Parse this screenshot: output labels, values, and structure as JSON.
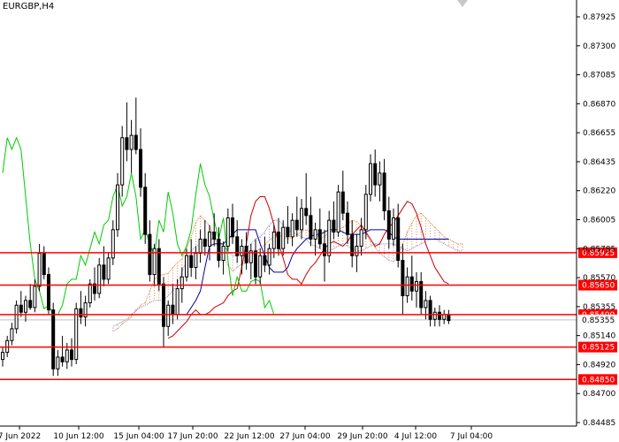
{
  "window": {
    "title": "EURGBP,H4"
  },
  "colors": {
    "background": "#ffffff",
    "candles": "#000000",
    "level_line": "#ff0000",
    "level_label_bg": "#ff0000",
    "chikou": "#00cc00",
    "tenkan": "#cc0000",
    "kijun": "#0000aa",
    "kumo_up": "#e08040",
    "kumo_down": "#9080c0",
    "bid_line": "#c0c0c0"
  },
  "price_axis": {
    "min": 0.84485,
    "max": 0.87925,
    "ticks": [
      "0.87925",
      "0.87300",
      "0.87085",
      "0.86870",
      "0.86655",
      "0.86435",
      "0.86220",
      "0.86005",
      "0.85785",
      "0.85570",
      "0.85355",
      "0.85140",
      "0.84920",
      "0.84700",
      "0.84485"
    ]
  },
  "time_axis": {
    "labels": [
      "7 Jun 2022",
      "10 Jun 12:00",
      "15 Jun 04:00",
      "17 Jun 20:00",
      "22 Jun 12:00",
      "27 Jun 04:00",
      "29 Jun 20:00",
      "4 Jul 12:00",
      "7 Jul 04:00"
    ]
  },
  "levels": [
    {
      "price": 0.85925,
      "label": "0.85925"
    },
    {
      "price": 0.8565,
      "label": "0.85650"
    },
    {
      "price": 0.854,
      "label": "0.85400"
    },
    {
      "price": 0.85125,
      "label": "0.85125"
    },
    {
      "price": 0.8485,
      "label": "0.84850"
    }
  ],
  "bid": {
    "price": 0.85355,
    "label": "0.85355"
  },
  "candles": [
    [
      0.8502,
      0.8512,
      0.8496,
      0.8508
    ],
    [
      0.8508,
      0.8522,
      0.8504,
      0.8518
    ],
    [
      0.8518,
      0.8533,
      0.8514,
      0.8528
    ],
    [
      0.8528,
      0.8552,
      0.8524,
      0.8548
    ],
    [
      0.8548,
      0.856,
      0.8538,
      0.8542
    ],
    [
      0.8542,
      0.8556,
      0.8534,
      0.8552
    ],
    [
      0.8552,
      0.8566,
      0.8544,
      0.8546
    ],
    [
      0.8546,
      0.857,
      0.8542,
      0.8564
    ],
    [
      0.8564,
      0.86,
      0.856,
      0.8592
    ],
    [
      0.8592,
      0.8598,
      0.857,
      0.8574
    ],
    [
      0.8574,
      0.858,
      0.854,
      0.8544
    ],
    [
      0.8544,
      0.855,
      0.8488,
      0.8494
    ],
    [
      0.8494,
      0.851,
      0.8488,
      0.8504
    ],
    [
      0.8504,
      0.8522,
      0.8496,
      0.85
    ],
    [
      0.85,
      0.8516,
      0.8494,
      0.851
    ],
    [
      0.851,
      0.852,
      0.8496,
      0.8502
    ],
    [
      0.8502,
      0.855,
      0.8498,
      0.8545
    ],
    [
      0.8545,
      0.856,
      0.8532,
      0.8538
    ],
    [
      0.8538,
      0.8556,
      0.853,
      0.855
    ],
    [
      0.855,
      0.857,
      0.8546,
      0.8566
    ],
    [
      0.8566,
      0.858,
      0.8552,
      0.8558
    ],
    [
      0.8558,
      0.8588,
      0.8554,
      0.8582
    ],
    [
      0.8582,
      0.8598,
      0.8564,
      0.857
    ],
    [
      0.857,
      0.8592,
      0.8566,
      0.8588
    ],
    [
      0.8588,
      0.862,
      0.8582,
      0.8612
    ],
    [
      0.8612,
      0.866,
      0.8606,
      0.865
    ],
    [
      0.865,
      0.87,
      0.864,
      0.869
    ],
    [
      0.869,
      0.872,
      0.867,
      0.868
    ],
    [
      0.868,
      0.8705,
      0.866,
      0.8692
    ],
    [
      0.8692,
      0.8724,
      0.8676,
      0.868
    ],
    [
      0.868,
      0.8698,
      0.864,
      0.8648
    ],
    [
      0.8648,
      0.866,
      0.86,
      0.8608
    ],
    [
      0.8608,
      0.862,
      0.8568,
      0.8574
    ],
    [
      0.8574,
      0.86,
      0.8564,
      0.8596
    ],
    [
      0.8596,
      0.8604,
      0.856,
      0.8566
    ],
    [
      0.8566,
      0.8572,
      0.8512,
      0.853
    ],
    [
      0.853,
      0.8552,
      0.8522,
      0.8548
    ],
    [
      0.8548,
      0.8566,
      0.8532,
      0.854
    ],
    [
      0.854,
      0.857,
      0.8536,
      0.8562
    ],
    [
      0.8562,
      0.858,
      0.855,
      0.8572
    ],
    [
      0.8572,
      0.8596,
      0.8568,
      0.859
    ],
    [
      0.859,
      0.8604,
      0.8572,
      0.858
    ],
    [
      0.858,
      0.8598,
      0.857,
      0.8592
    ],
    [
      0.8592,
      0.8612,
      0.8584,
      0.8604
    ],
    [
      0.8604,
      0.862,
      0.859,
      0.8598
    ],
    [
      0.8598,
      0.8616,
      0.8586,
      0.861
    ],
    [
      0.861,
      0.8626,
      0.8598,
      0.8604
    ],
    [
      0.8604,
      0.8614,
      0.858,
      0.8586
    ],
    [
      0.8586,
      0.8602,
      0.8574,
      0.8598
    ],
    [
      0.8598,
      0.863,
      0.8594,
      0.8622
    ],
    [
      0.8622,
      0.8634,
      0.86,
      0.8606
    ],
    [
      0.8606,
      0.862,
      0.8584,
      0.859
    ],
    [
      0.859,
      0.8604,
      0.8574,
      0.8598
    ],
    [
      0.8598,
      0.861,
      0.8578,
      0.8584
    ],
    [
      0.8584,
      0.86,
      0.857,
      0.8594
    ],
    [
      0.8594,
      0.8604,
      0.8566,
      0.8572
    ],
    [
      0.8572,
      0.8596,
      0.8566,
      0.859
    ],
    [
      0.859,
      0.8606,
      0.8576,
      0.8582
    ],
    [
      0.8582,
      0.86,
      0.8574,
      0.8596
    ],
    [
      0.8596,
      0.8616,
      0.8588,
      0.861
    ],
    [
      0.861,
      0.8622,
      0.859,
      0.8596
    ],
    [
      0.8596,
      0.862,
      0.859,
      0.8614
    ],
    [
      0.8614,
      0.8632,
      0.86,
      0.8606
    ],
    [
      0.8606,
      0.8626,
      0.8598,
      0.862
    ],
    [
      0.862,
      0.864,
      0.8606,
      0.8612
    ],
    [
      0.8612,
      0.8638,
      0.8604,
      0.863
    ],
    [
      0.863,
      0.866,
      0.8616,
      0.8624
    ],
    [
      0.8624,
      0.864,
      0.8598,
      0.8604
    ],
    [
      0.8604,
      0.8618,
      0.859,
      0.8612
    ],
    [
      0.8612,
      0.863,
      0.8596,
      0.86
    ],
    [
      0.86,
      0.8612,
      0.8568,
      0.859
    ],
    [
      0.859,
      0.8628,
      0.8584,
      0.862
    ],
    [
      0.862,
      0.8636,
      0.8604,
      0.861
    ],
    [
      0.861,
      0.865,
      0.8606,
      0.8644
    ],
    [
      0.8644,
      0.8662,
      0.862,
      0.8626
    ],
    [
      0.8626,
      0.8636,
      0.86,
      0.8608
    ],
    [
      0.8608,
      0.862,
      0.858,
      0.859
    ],
    [
      0.859,
      0.8608,
      0.8576,
      0.8598
    ],
    [
      0.8598,
      0.8622,
      0.859,
      0.8612
    ],
    [
      0.8612,
      0.865,
      0.8604,
      0.8642
    ],
    [
      0.8642,
      0.8676,
      0.8636,
      0.8668
    ],
    [
      0.8668,
      0.868,
      0.864,
      0.865
    ],
    [
      0.865,
      0.867,
      0.8636,
      0.866
    ],
    [
      0.866,
      0.8672,
      0.862,
      0.8628
    ],
    [
      0.8628,
      0.864,
      0.8596,
      0.8604
    ],
    [
      0.8604,
      0.863,
      0.8598,
      0.8622
    ],
    [
      0.8622,
      0.8634,
      0.858,
      0.8586
    ],
    [
      0.8586,
      0.86,
      0.854,
      0.8556
    ],
    [
      0.8556,
      0.858,
      0.855,
      0.8572
    ],
    [
      0.8572,
      0.859,
      0.8552,
      0.856
    ],
    [
      0.856,
      0.8576,
      0.8546,
      0.8568
    ],
    [
      0.8568,
      0.8576,
      0.854,
      0.8546
    ],
    [
      0.8546,
      0.856,
      0.8536,
      0.8552
    ],
    [
      0.8552,
      0.8556,
      0.853,
      0.8536
    ],
    [
      0.8536,
      0.8546,
      0.853,
      0.8542
    ],
    [
      0.8542,
      0.8548,
      0.853,
      0.8536
    ],
    [
      0.8536,
      0.8544,
      0.8532,
      0.854
    ],
    [
      0.854,
      0.8544,
      0.8532,
      0.8535
    ]
  ],
  "indicators": {
    "tenkan": [
      0.852,
      0.8522,
      0.8526,
      0.853,
      0.8534,
      0.854,
      0.8544,
      0.854,
      0.854,
      0.8542,
      0.8546,
      0.8548,
      0.855,
      0.8556,
      0.856,
      0.8562,
      0.858,
      0.86,
      0.8624,
      0.8636,
      0.864,
      0.864,
      0.863,
      0.8616,
      0.86,
      0.8588,
      0.8574,
      0.857,
      0.857,
      0.8566,
      0.8574,
      0.858,
      0.8584,
      0.859,
      0.8596,
      0.86,
      0.8602,
      0.86,
      0.8598,
      0.8602,
      0.8608,
      0.8612,
      0.8616,
      0.861,
      0.8604,
      0.8598,
      0.86,
      0.8608,
      0.8614,
      0.8618,
      0.8624,
      0.863,
      0.8636,
      0.8634,
      0.8626,
      0.8614,
      0.86,
      0.859,
      0.858,
      0.8574,
      0.8568,
      0.8566
    ],
    "kijun": [
      0.854,
      0.854,
      0.854,
      0.854,
      0.854,
      0.8546,
      0.8552,
      0.856,
      0.858,
      0.8598,
      0.86,
      0.86,
      0.86,
      0.8604,
      0.8608,
      0.8612,
      0.8612,
      0.8612,
      0.8612,
      0.8612,
      0.86,
      0.859,
      0.858,
      0.8576,
      0.8576,
      0.8576,
      0.858,
      0.859,
      0.8596,
      0.86,
      0.8604,
      0.8606,
      0.8608,
      0.8608,
      0.861,
      0.8612,
      0.8612,
      0.8612,
      0.861,
      0.8608,
      0.8608,
      0.8608,
      0.8608,
      0.861,
      0.8612,
      0.8612,
      0.8612,
      0.8612,
      0.861,
      0.8606,
      0.8604,
      0.8604,
      0.8604,
      0.8604,
      0.8604,
      0.8604,
      0.8604,
      0.8604,
      0.8604,
      0.8604,
      0.8604,
      0.8604
    ],
    "chikou": [
      0.866,
      0.869,
      0.868,
      0.869,
      0.868,
      0.864,
      0.86,
      0.857,
      0.856,
      0.8545,
      0.8548,
      0.854,
      0.854,
      0.8548,
      0.8566,
      0.857,
      0.857,
      0.859,
      0.8582,
      0.8596,
      0.861,
      0.86,
      0.8616,
      0.862,
      0.864,
      0.865,
      0.8632,
      0.864,
      0.866,
      0.864,
      0.8604,
      0.8612,
      0.86,
      0.859,
      0.862,
      0.861,
      0.8644,
      0.8626,
      0.86,
      0.859,
      0.8598,
      0.8612,
      0.8642,
      0.8668,
      0.865,
      0.864,
      0.862,
      0.8604,
      0.8622,
      0.8586,
      0.8556,
      0.8572,
      0.856,
      0.856,
      0.8568,
      0.857,
      0.8568,
      0.8546,
      0.8552,
      0.854,
      0.854,
      0.854
    ],
    "senkou_a": [
      0.8526,
      0.8528,
      0.8532,
      0.8535,
      0.8538,
      0.8543,
      0.8548,
      0.855,
      0.856,
      0.857,
      0.8573,
      0.8574,
      0.8575,
      0.858,
      0.8584,
      0.8587,
      0.8596,
      0.8606,
      0.8618,
      0.8624,
      0.862,
      0.8615,
      0.8605,
      0.8596,
      0.8588,
      0.8582,
      0.8577,
      0.858,
      0.8583,
      0.8583,
      0.8589,
      0.8593,
      0.8596,
      0.8599,
      0.8603,
      0.8606,
      0.8607,
      0.8606,
      0.8604,
      0.8605,
      0.8608,
      0.861,
      0.8612,
      0.861,
      0.8608,
      0.8605,
      0.8606,
      0.861,
      0.8612,
      0.8612,
      0.8614,
      0.8617,
      0.862,
      0.8619,
      0.8615,
      0.8609,
      0.8602,
      0.8597,
      0.8592,
      0.8589,
      0.8586,
      0.8585,
      0.859,
      0.86,
      0.861,
      0.8618,
      0.8624,
      0.8626,
      0.8622,
      0.8618,
      0.8614,
      0.861,
      0.8606,
      0.8604,
      0.8602,
      0.86,
      0.86
    ],
    "senkou_b": [
      0.853,
      0.8532,
      0.8534,
      0.8536,
      0.854,
      0.8544,
      0.8546,
      0.8548,
      0.855,
      0.8552,
      0.8552,
      0.8552,
      0.8556,
      0.856,
      0.8566,
      0.8576,
      0.8586,
      0.8594,
      0.8598,
      0.86,
      0.8602,
      0.8604,
      0.8604,
      0.8602,
      0.8598,
      0.8594,
      0.859,
      0.859,
      0.8592,
      0.8596,
      0.86,
      0.8604,
      0.8606,
      0.861,
      0.8616,
      0.862,
      0.862,
      0.8616,
      0.8612,
      0.861,
      0.8608,
      0.8606,
      0.8604,
      0.86,
      0.8598,
      0.8596,
      0.8594,
      0.8594,
      0.8596,
      0.8598,
      0.86,
      0.8598,
      0.8596,
      0.8594,
      0.8594,
      0.8596,
      0.8598,
      0.86,
      0.86,
      0.86,
      0.86,
      0.86,
      0.8598,
      0.8596,
      0.8594,
      0.8596,
      0.8598,
      0.86,
      0.8602,
      0.8604,
      0.8604,
      0.8602,
      0.86,
      0.8598,
      0.8596,
      0.8594,
      0.8594
    ]
  }
}
